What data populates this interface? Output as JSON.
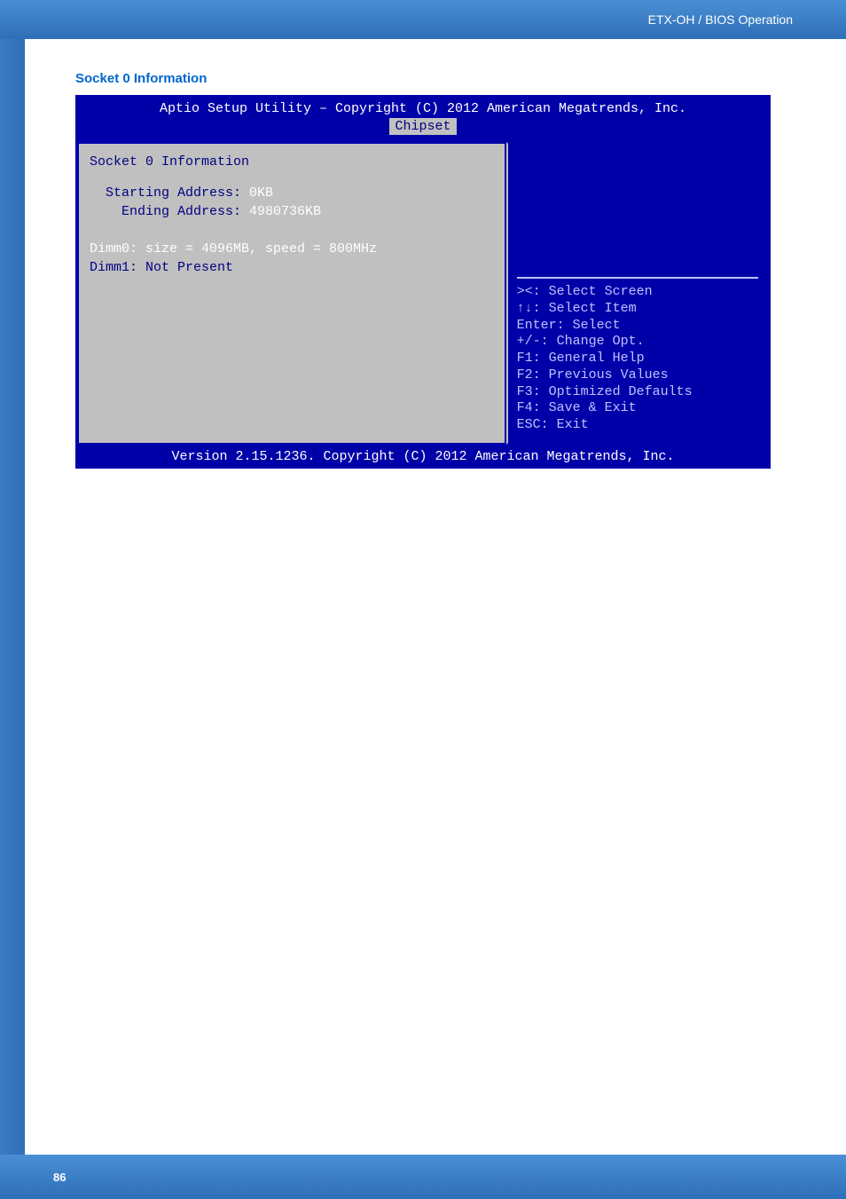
{
  "header": {
    "breadcrumb": "ETX-OH / BIOS Operation"
  },
  "section": {
    "title": "Socket 0 Information"
  },
  "bios": {
    "top_line": "Aptio Setup Utility – Copyright (C) 2012 American Megatrends, Inc.",
    "tab": "Chipset",
    "panel_title": "Socket 0 Information",
    "starting_addr_label": "Starting Address:",
    "starting_addr_value": "0KB",
    "ending_addr_label": "Ending Address:",
    "ending_addr_value": "4980736KB",
    "dimm0": "Dimm0: size = 4096MB, speed = 800MHz",
    "dimm1": "Dimm1: Not Present",
    "help": {
      "l1": "><: Select Screen",
      "l2": "↑↓: Select Item",
      "l3": "Enter: Select",
      "l4": "+/-: Change Opt.",
      "l5": "F1: General Help",
      "l6": "F2: Previous Values",
      "l7": "F3: Optimized Defaults",
      "l8": "F4: Save & Exit",
      "l9": "ESC: Exit"
    },
    "footer_line": "Version 2.15.1236. Copyright (C) 2012 American Megatrends, Inc."
  },
  "footer": {
    "page_number": "86"
  }
}
